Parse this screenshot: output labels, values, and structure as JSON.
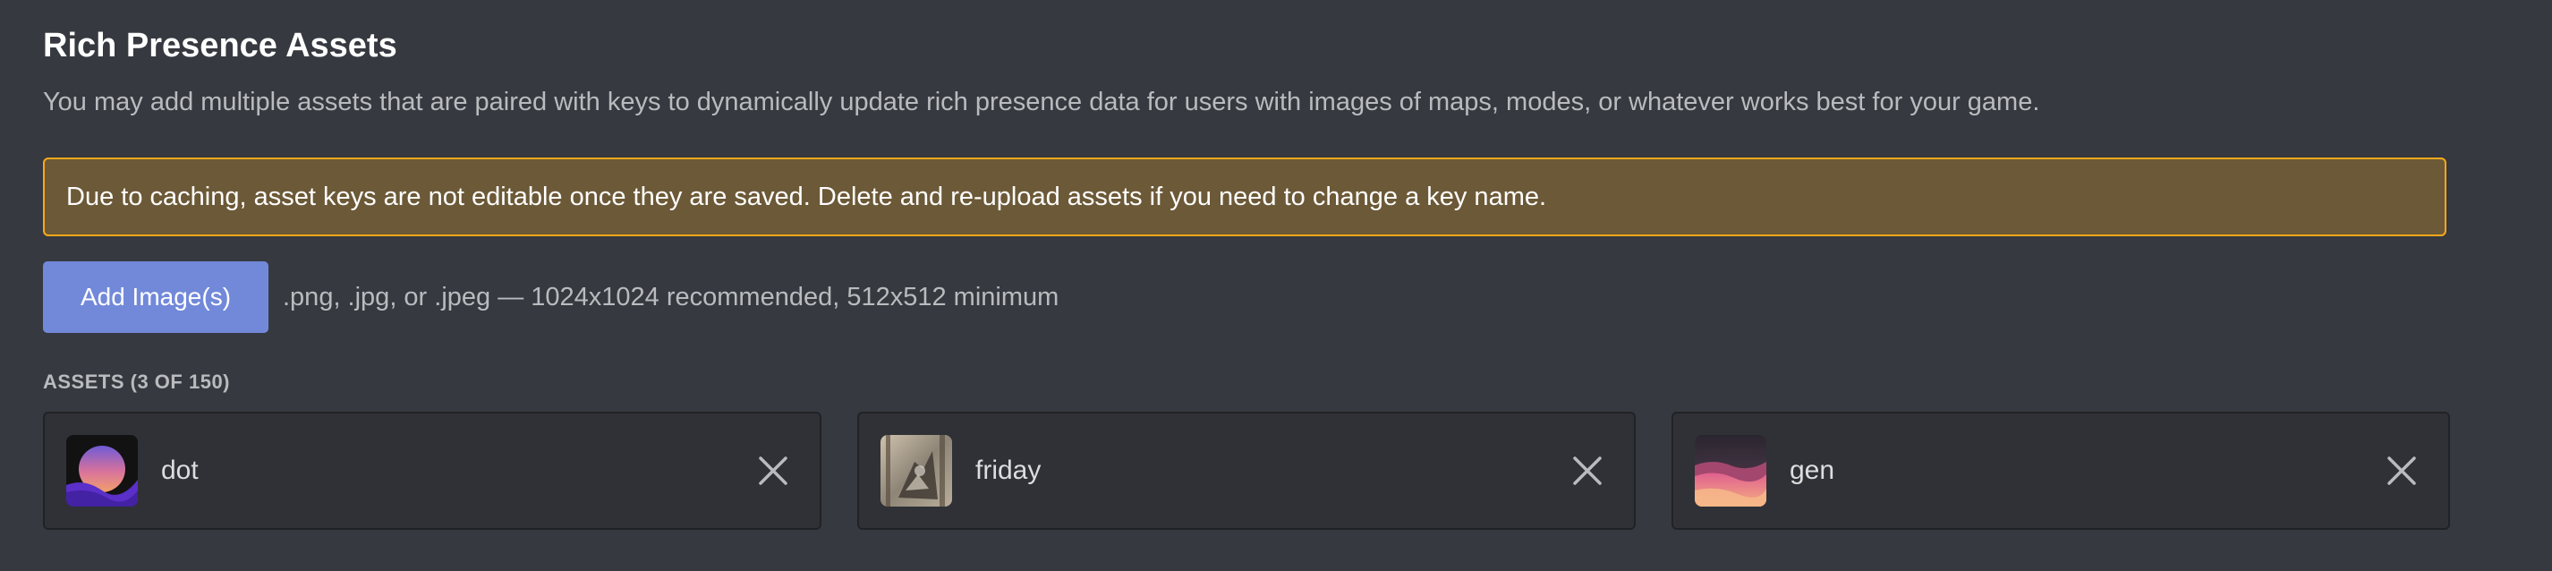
{
  "section": {
    "title": "Rich Presence Assets",
    "description": "You may add multiple assets that are paired with keys to dynamically update rich presence data for users with images of maps, modes, or whatever works best for your game."
  },
  "warning": {
    "text": "Due to caching, asset keys are not editable once they are saved. Delete and re-upload assets if you need to change a key name.",
    "border_color": "#faa81a",
    "background": "#6c5937"
  },
  "upload": {
    "button_label": "Add Image(s)",
    "hint": ".png, .jpg, or .jpeg — 1024x1024 recommended, 512x512 minimum",
    "button_color": "#7289da"
  },
  "assets": {
    "label": "ASSETS (3 OF 150)",
    "items": [
      {
        "key": "dot",
        "thumbnail": "dot-image",
        "remove_icon": "close-icon"
      },
      {
        "key": "friday",
        "thumbnail": "friday-image",
        "remove_icon": "close-icon"
      },
      {
        "key": "gen",
        "thumbnail": "gen-image",
        "remove_icon": "close-icon"
      }
    ]
  },
  "colors": {
    "background": "#36393f",
    "card": "#2f3136",
    "text_muted": "#b9bbbe"
  }
}
